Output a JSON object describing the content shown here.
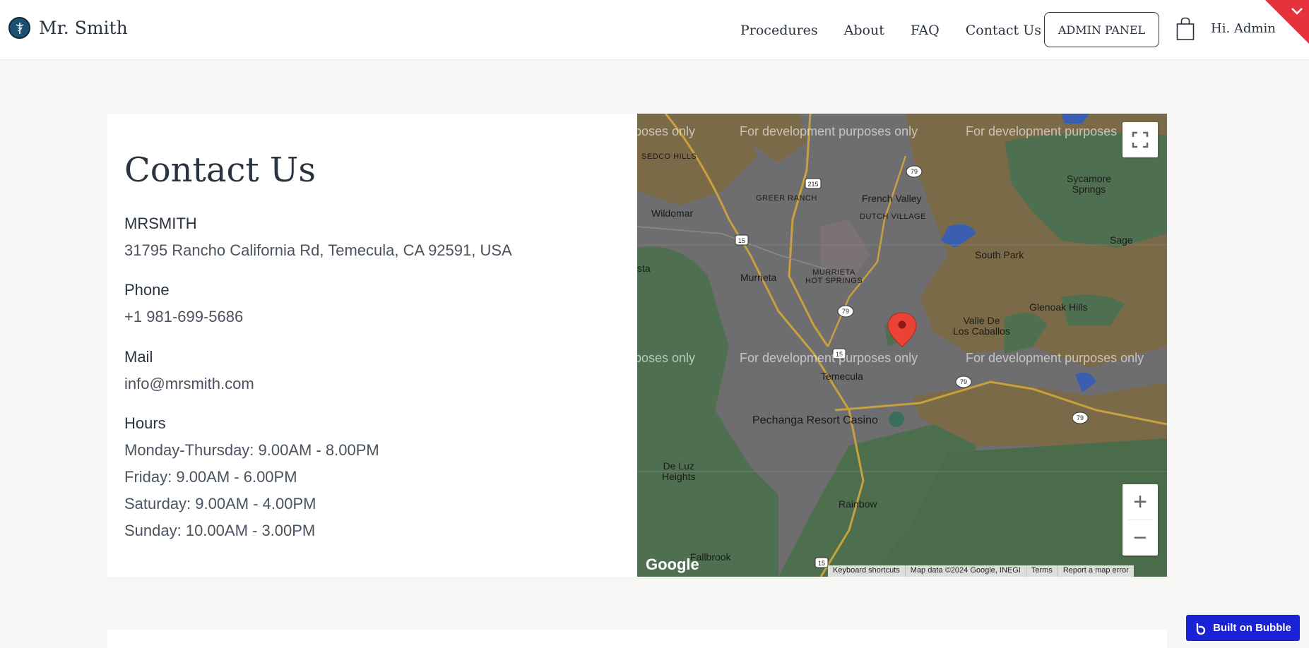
{
  "header": {
    "brand": "Mr. Smith",
    "nav": [
      "Procedures",
      "About",
      "FAQ",
      "Contact Us"
    ],
    "admin_button": "ADMIN PANEL",
    "greeting": "Hi. Admin"
  },
  "contact": {
    "title": "Contact Us",
    "company_label": "MRSMITH",
    "address": "31795 Rancho California Rd, Temecula, CA 92591, USA",
    "phone_label": "Phone",
    "phone": "+1 981-699-5686",
    "mail_label": "Mail",
    "email": "info@mrsmith.com",
    "hours_label": "Hours",
    "hours": [
      "Monday-Thursday: 9.00AM - 8.00PM",
      "Friday: 9.00AM - 6.00PM",
      "Saturday: 9.00AM - 4.00PM",
      "Sunday: 10.00AM - 3.00PM"
    ]
  },
  "map": {
    "watermark": "For development purposes only",
    "watermark_partial_left": "poses only",
    "watermark_partial_right": "For development purposes",
    "places": {
      "sedco_hills": "SEDCO HILLS",
      "greer_ranch": "GREER RANCH",
      "french_valley": "French Valley",
      "dutch_village": "DUTCH VILLAGE",
      "sycamore_springs": "Sycamore\nSprings",
      "wildomar": "Wildomar",
      "sage": "Sage",
      "south_park": "South Park",
      "murrieta_hot_springs": "MURRIETA\nHOT SPRINGS",
      "murrieta": "Murrieta",
      "vista_partial": "sta",
      "glenoak_hills": "Glenoak Hills",
      "valle_de_los_caballos": "Valle De\nLos Caballos",
      "temecula": "Temecula",
      "pechanga": "Pechanga Resort Casino",
      "de_luz_heights": "De Luz\nHeights",
      "rainbow": "Rainbow",
      "fallbrook": "Fallbrook"
    },
    "shields": [
      "215",
      "79",
      "15",
      "79",
      "15",
      "79",
      "79",
      "15"
    ],
    "google_logo": "Google",
    "attribution": [
      "Keyboard shortcuts",
      "Map data ©2024 Google, INEGI",
      "Terms",
      "Report a map error"
    ],
    "zoom_in": "+",
    "zoom_out": "−"
  },
  "badge": {
    "label": "Built on Bubble"
  },
  "colors": {
    "accent_corner": "#e6323c",
    "bubble_blue": "#1a22d6",
    "text_dark": "#2a3340",
    "map_pin": "#ea4335"
  }
}
